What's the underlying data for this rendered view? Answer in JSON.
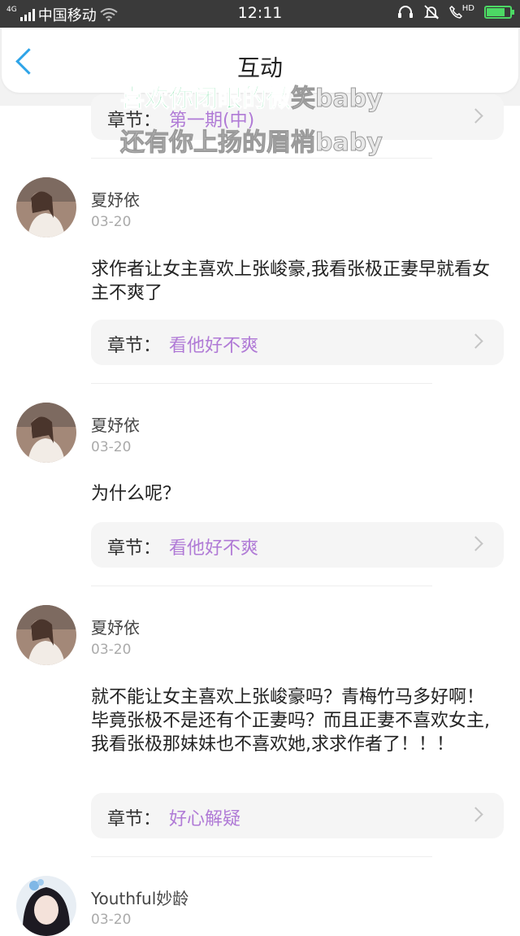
{
  "status_bar": {
    "network": "4G",
    "carrier": "中国移动",
    "time": "12:11",
    "hd": "HD",
    "battery_level": 0.8
  },
  "header": {
    "title": "互动"
  },
  "lyrics": {
    "line1_highlight": "喜欢你闭眼的微",
    "line1_rest": "笑baby",
    "line2": "还有你上扬的眉梢baby"
  },
  "top_chapter": {
    "label": "章节：",
    "value": "第一期(中)"
  },
  "comments": [
    {
      "name": "夏妤依",
      "date": "03-20",
      "text": "求作者让女主喜欢上张峻豪,我看张极正妻早就看女主不爽了",
      "chapter_label": "章节：",
      "chapter_value": "看他好不爽"
    },
    {
      "name": "夏妤依",
      "date": "03-20",
      "text": "为什么呢？",
      "chapter_label": "章节：",
      "chapter_value": "看他好不爽"
    },
    {
      "name": "夏妤依",
      "date": "03-20",
      "text": "就不能让女主喜欢上张峻豪吗？青梅竹马多好啊！毕竟张极不是还有个正妻吗？而且正妻不喜欢女主,我看张极那妹妹也不喜欢她,求求作者了！！！",
      "chapter_label": "章节：",
      "chapter_value": "好心解疑"
    },
    {
      "name": "Youthful妙龄",
      "date": "03-20"
    }
  ]
}
